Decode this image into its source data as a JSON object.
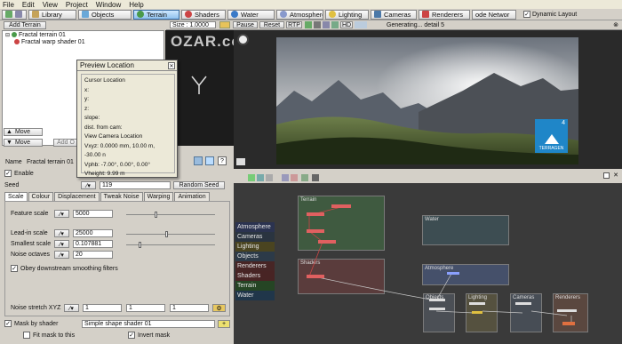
{
  "menubar": [
    "File",
    "Edit",
    "View",
    "Project",
    "Window",
    "Help"
  ],
  "toolbar": {
    "tabs": [
      {
        "label": "Library",
        "color": "#c5a35a"
      },
      {
        "label": "Objects",
        "color": "#6aa8d8"
      },
      {
        "label": "Terrain",
        "color": "#4a9a4a"
      },
      {
        "label": "Shaders",
        "color": "#c44"
      },
      {
        "label": "Water",
        "color": "#3a7ac8"
      },
      {
        "label": "Atmosphere",
        "color": "#8899cc"
      },
      {
        "label": "Lighting",
        "color": "#e0c040"
      },
      {
        "label": "Cameras",
        "color": "#4a78a8"
      },
      {
        "label": "Renderers",
        "color": "#c44"
      },
      {
        "label": "ode Networ",
        "color": "#888"
      }
    ],
    "dynamic_layout": "Dynamic Layout"
  },
  "left": {
    "add_terrain": "Add Terrain",
    "tree": [
      "Fractal terrain 01",
      "Fractal warp shader 01"
    ],
    "move1": "Move",
    "move2": "Move",
    "add_o": "Add O",
    "name_label": "Name",
    "name_value": "Fractal terrain 01",
    "enable": "Enable",
    "seed_label": "Seed",
    "seed_value": "119",
    "random_seed": "Random Seed",
    "tabs": [
      "Scale",
      "Colour",
      "Displacement",
      "Tweak Noise",
      "Warping",
      "Animation"
    ],
    "params": [
      {
        "label": "Feature scale",
        "value": "5000"
      },
      {
        "label": "Lead-in scale",
        "value": "25000"
      },
      {
        "label": "Smallest scale",
        "value": "0.107881"
      },
      {
        "label": "Noise octaves",
        "value": "20"
      }
    ],
    "obey": "Obey downstream smoothing filters",
    "stretch_label": "Noise stretch XYZ",
    "stretch_values": [
      "1",
      "1",
      "1"
    ],
    "mask_label": "Mask by shader",
    "mask_value": "Simple shape shader 01",
    "fit_mask": "Fit mask to this",
    "invert_mask": "Invert mask"
  },
  "preview": {
    "title": "Preview Location",
    "cursor_header": "Cursor Location",
    "x": "x:",
    "y": "y:",
    "z": "z:",
    "slope": "slope:",
    "dist": "dist. from cam:",
    "view_header": "View Camera Location",
    "vxyz": "Vxyz: 0.0000 mm, 10.00 m, -30.00 n",
    "vphb": "Vphb: -7.00°, 0.00°, 0.00°",
    "vheight": "Vheight: 9.99 m"
  },
  "render_toolbar": {
    "size": "Size : 1.0000",
    "pause": "Pause",
    "reset": "Reset",
    "rtp": "RTP",
    "hd": "HD",
    "status": "Generating... detail 5"
  },
  "watermark": "OZAR.com",
  "logo_text": "TERRAGEN",
  "logo_num": "4",
  "network": {
    "categories": [
      {
        "label": "Atmosphere",
        "color": "#2b3350"
      },
      {
        "label": "Cameras",
        "color": "#2a3440"
      },
      {
        "label": "Lighting",
        "color": "#4a4420"
      },
      {
        "label": "Objects",
        "color": "#2c3a48"
      },
      {
        "label": "Renderers",
        "color": "#472525"
      },
      {
        "label": "Shaders",
        "color": "#482424"
      },
      {
        "label": "Terrain",
        "color": "#254524"
      },
      {
        "label": "Water",
        "color": "#20364a"
      }
    ],
    "groups": {
      "terrain": "Terrain",
      "water": "Water",
      "shaders": "Shaders",
      "atmosphere": "Atmosphere",
      "objects": "Objects",
      "lighting": "Lighting",
      "cameras": "Cameras",
      "renderers": "Renderers"
    }
  }
}
